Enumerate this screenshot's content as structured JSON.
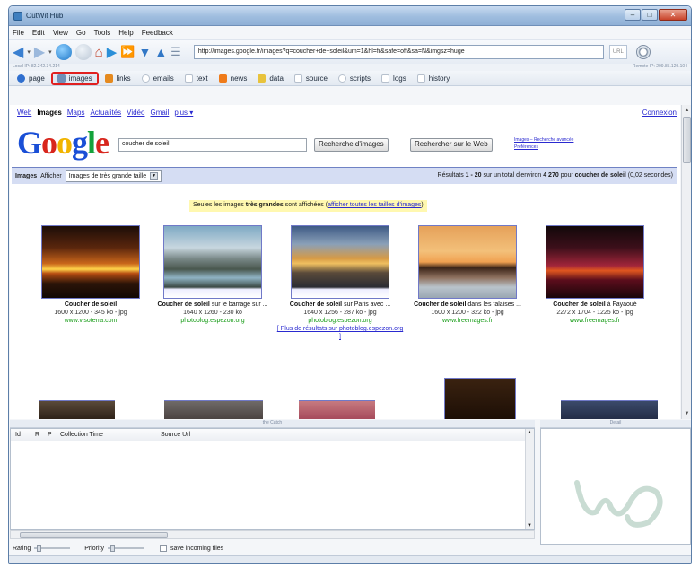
{
  "window": {
    "title": "OutWit Hub"
  },
  "menu": [
    "File",
    "Edit",
    "View",
    "Go",
    "Tools",
    "Help",
    "Feedback"
  ],
  "url": "http://images.google.fr/images?q=coucher+de+soleil&um=1&hl=fr&safe=off&sa=N&imgsz=huge",
  "ip": {
    "local": "Local IP: 82.242.34.214",
    "remote": "Remote IP: 209.85.129.104"
  },
  "views": [
    {
      "label": "page",
      "icon": "page-icon",
      "color": "#2f6fcf"
    },
    {
      "label": "images",
      "icon": "images-icon",
      "color": "#6f8fb8",
      "active": true
    },
    {
      "label": "links",
      "icon": "links-icon",
      "color": "#e58a1f"
    },
    {
      "label": "emails",
      "icon": "emails-icon",
      "color": "#c9cfd8"
    },
    {
      "label": "text",
      "icon": "text-icon",
      "color": "#c9cfd8"
    },
    {
      "label": "news",
      "icon": "news-icon",
      "color": "#ef7b1a"
    },
    {
      "label": "data",
      "icon": "data-icon",
      "color": "#e8c33c"
    },
    {
      "label": "source",
      "icon": "source-icon",
      "color": "#c9cfd8"
    },
    {
      "label": "scripts",
      "icon": "scripts-icon",
      "color": "#c9cfd8"
    },
    {
      "label": "logs",
      "icon": "logs-icon",
      "color": "#c9cfd8"
    },
    {
      "label": "history",
      "icon": "history-icon",
      "color": "#c9cfd8"
    }
  ],
  "google": {
    "nav": [
      "Web",
      "Images",
      "Maps",
      "Actualités",
      "Vidéo",
      "Gmail",
      "plus ▾"
    ],
    "connexion": "Connexion",
    "logo": [
      "G",
      "o",
      "o",
      "g",
      "l",
      "e"
    ],
    "logo_colors": [
      "#1a4fd6",
      "#d8261d",
      "#f1b400",
      "#1a4fd6",
      "#14a23b",
      "#d8261d"
    ],
    "query": "coucher de soleil",
    "btn_images": "Recherche d'images",
    "btn_web": "Rechercher sur le Web",
    "adv1": "Images – Recherche avancée",
    "adv2": "Préférences",
    "bar_images": "Images",
    "bar_afficher": "Afficher",
    "bar_select": "Images de très grande taille",
    "results_prefix": "Résultats ",
    "results_range": "1 - 20",
    "results_mid": " sur un total d'environ ",
    "results_total": "4 270",
    "results_pour": " pour ",
    "results_query": "coucher de soleil",
    "results_time": " (0,02 secondes)",
    "notice_pre": "Seules les images ",
    "notice_bold": "très grandes",
    "notice_mid": " sont affichées (",
    "notice_link": "afficher toutes les tailles d'images",
    "notice_end": ")"
  },
  "results": [
    {
      "title_bold": "Coucher de soleil",
      "title_rest": "",
      "size": "1600 x 1200 - 345 ko - jpg",
      "site": "www.visoterra.com",
      "more": ""
    },
    {
      "title_bold": "Coucher de soleil",
      "title_rest": " sur le barrage sur ...",
      "size": "1640 x 1260 - 230 ko",
      "site": "photoblog.espezon.org",
      "more": ""
    },
    {
      "title_bold": "Coucher de soleil",
      "title_rest": " sur Paris avec ...",
      "size": "1640 x 1256 - 287 ko - jpg",
      "site": "photoblog.espezon.org",
      "more": "[ Plus de résultats sur photoblog.espezon.org ]"
    },
    {
      "title_bold": "Coucher de soleil",
      "title_rest": " dans les falaises ...",
      "size": "1600 x 1200 - 322 ko - jpg",
      "site": "www.freemages.fr",
      "more": ""
    },
    {
      "title_bold": "Coucher de soleil",
      "title_rest": " à Fayaoué",
      "size": "2272 x 1704 - 1225 ko - jpg",
      "site": "www.freemages.fr",
      "more": ""
    }
  ],
  "panes": {
    "catch_title": "the Catch",
    "detail_title": "Detail"
  },
  "columns": [
    "Id",
    "R",
    "P",
    "Collection Time",
    "Source Url"
  ],
  "bottom": {
    "rating": "Rating",
    "priority": "Priority",
    "save": "save incoming files"
  }
}
